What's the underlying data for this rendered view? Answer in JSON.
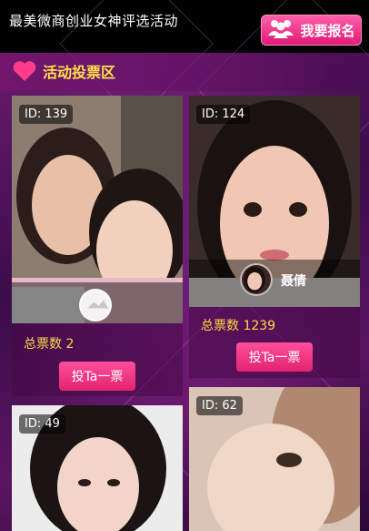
{
  "header": {
    "title": "最美微商创业女神评选活动",
    "signup_label": "我要报名"
  },
  "section": {
    "title": "活动投票区"
  },
  "cards": [
    {
      "id_label": "ID: 139",
      "votes_label": "总票数 2",
      "vote_button": "投Ta一票",
      "name": ""
    },
    {
      "id_label": "ID: 124",
      "votes_label": "总票数 1239",
      "vote_button": "投Ta一票",
      "name": "聂倩"
    },
    {
      "id_label": "ID: 49"
    },
    {
      "id_label": "ID: 62"
    }
  ],
  "colors": {
    "accent_pink": "#e8237a",
    "vote_text": "#ffd84a",
    "title_yellow": "#ffe24a"
  }
}
